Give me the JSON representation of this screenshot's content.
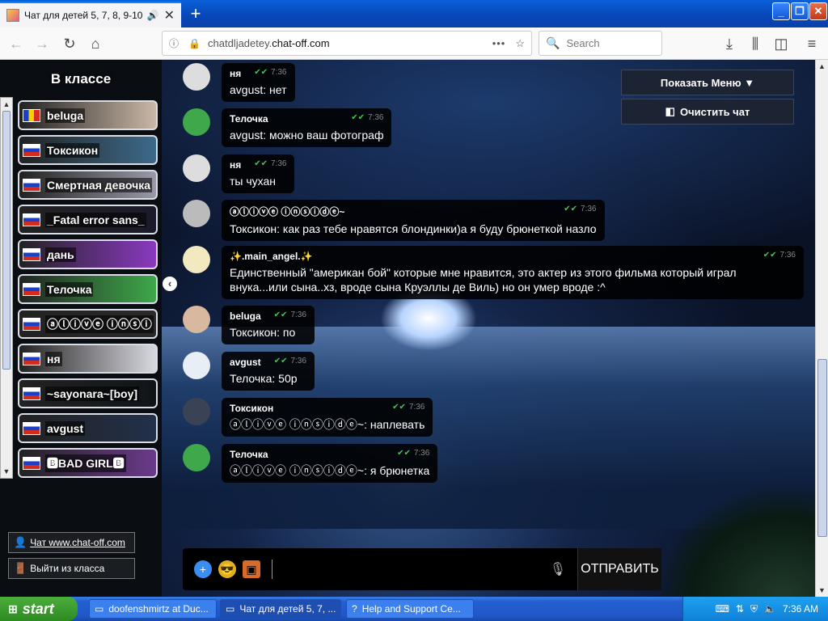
{
  "browser": {
    "tab_title": "Чат для детей 5, 7, 8, 9-10,",
    "tab_close": "✕",
    "new_tab": "+",
    "url_prefix": "chatdljadetey.",
    "url_domain": "chat-off.com",
    "url_more": "•••",
    "search_placeholder": "Search",
    "win_min": "_",
    "win_max": "❐",
    "win_close": "✕"
  },
  "sidebar": {
    "title": "В классе",
    "users": [
      {
        "name": "beluga",
        "flag": "ro"
      },
      {
        "name": "Токсикон",
        "flag": "ru"
      },
      {
        "name": "Смертная девочка",
        "flag": "ru"
      },
      {
        "name": "_Fatal error sans_",
        "flag": "ru"
      },
      {
        "name": "дань",
        "flag": "ru"
      },
      {
        "name": "Телочка",
        "flag": "ru"
      },
      {
        "name": "ⓐⓛⓘⓥⓔ ⓘⓝⓢⓘ",
        "flag": "ru"
      },
      {
        "name": "ня",
        "flag": "ru"
      },
      {
        "name": "~sayonara~[boy]",
        "flag": "ru"
      },
      {
        "name": "avgust",
        "flag": "ru"
      },
      {
        "name": "🅱BAD GIRL🅱",
        "flag": "ru"
      }
    ],
    "link_chat": "Чат www.chat-off.com",
    "link_exit": "Выйти из класса"
  },
  "controls": {
    "show_menu": "Показать Меню ▼",
    "clear_chat": "Очистить чат"
  },
  "messages": [
    {
      "author": "ня",
      "time": "7:36",
      "text": "avgust: нет"
    },
    {
      "author": "Телочка",
      "time": "7:36",
      "text": "avgust: можно ваш фотограф"
    },
    {
      "author": "ня",
      "time": "7:36",
      "text": "ты чухан"
    },
    {
      "author": "ⓐⓛⓘⓥⓔ ⓘⓝⓢⓘⓓⓔ~",
      "time": "7:36",
      "text": "Токсикон: как раз тебе нравятся блондинки)а я буду брюнеткой назло"
    },
    {
      "author": "✨.main_angel.✨",
      "time": "7:36",
      "text": "Единственный \"американ бой\" которые мне нравится, это актер из этого фильма который играл внука...или сына..хз, вроде сына Круэллы де Виль) но он умер вроде :^"
    },
    {
      "author": "beluga",
      "time": "7:36",
      "text": "Токсикон: по"
    },
    {
      "author": "avgust",
      "time": "7:36",
      "text": "Телочка: 50р"
    },
    {
      "author": "Токсикон",
      "time": "7:36",
      "text": "ⓐⓛⓘⓥⓔ ⓘⓝⓢⓘⓓⓔ~: наплевать"
    },
    {
      "author": "Телочка",
      "time": "7:36",
      "text": "ⓐⓛⓘⓥⓔ ⓘⓝⓢⓘⓓⓔ~: я брюнетка"
    }
  ],
  "input": {
    "send_label": "ОТПРАВИТЬ"
  },
  "taskbar": {
    "start": "start",
    "items": [
      "doofenshmirtz at Duc...",
      "Чат для детей 5, 7, ...",
      "Help and Support Ce..."
    ],
    "clock": "7:36 AM"
  }
}
